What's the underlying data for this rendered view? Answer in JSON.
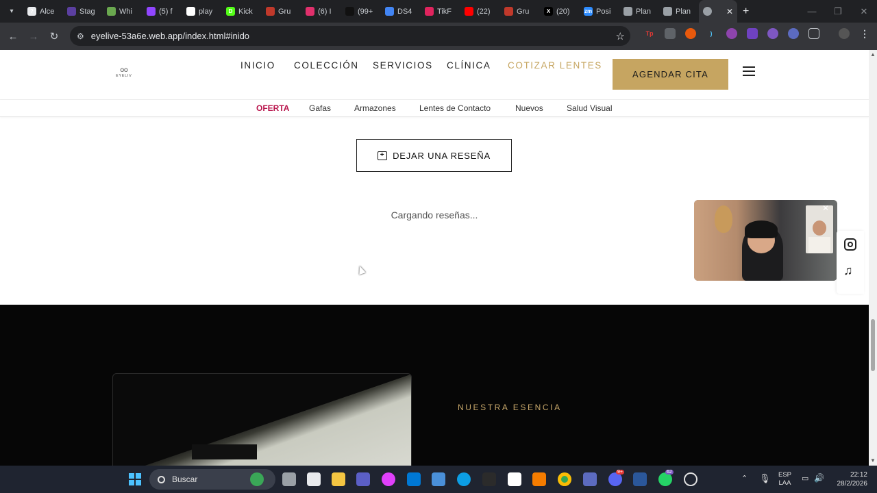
{
  "browser": {
    "tabs": [
      {
        "label": "Alce",
        "fav_color": "#e8eaed",
        "fav_glyph": "?"
      },
      {
        "label": "Stag",
        "fav_color": "#5b3fa0",
        "fav_glyph": ""
      },
      {
        "label": "Whi",
        "fav_color": "#6aa84f",
        "fav_glyph": ""
      },
      {
        "label": "(5) f",
        "fav_color": "#9146ff",
        "fav_glyph": ""
      },
      {
        "label": "play",
        "fav_color": "#ffffff",
        "fav_glyph": ""
      },
      {
        "label": "Kick",
        "fav_color": "#53fc18",
        "fav_glyph": "D"
      },
      {
        "label": "Gru",
        "fav_color": "#c0392b",
        "fav_glyph": ""
      },
      {
        "label": "(6) I",
        "fav_color": "#e1306c",
        "fav_glyph": ""
      },
      {
        "label": "(99+",
        "fav_color": "#111111",
        "fav_glyph": ""
      },
      {
        "label": "DS4",
        "fav_color": "#4285f4",
        "fav_glyph": ""
      },
      {
        "label": "TikF",
        "fav_color": "#e0245e",
        "fav_glyph": ""
      },
      {
        "label": "(22)",
        "fav_color": "#ff0000",
        "fav_glyph": ""
      },
      {
        "label": "Gru",
        "fav_color": "#c0392b",
        "fav_glyph": ""
      },
      {
        "label": "(20)",
        "fav_color": "#000000",
        "fav_glyph": "X"
      },
      {
        "label": "Posi",
        "fav_color": "#2d8cff",
        "fav_glyph": "zm"
      },
      {
        "label": "Plan",
        "fav_color": "#9aa0a6",
        "fav_glyph": ""
      },
      {
        "label": "Plan",
        "fav_color": "#9aa0a6",
        "fav_glyph": ""
      }
    ],
    "new_tab": "+",
    "url": "eyelive-53a6e.web.app/index.html#inido"
  },
  "site": {
    "logo_text": "EYELIV",
    "nav": [
      "INICIO",
      "COLECCIÓN",
      "SERVICIOS",
      "CLÍNICA",
      "COTIZAR LENTES"
    ],
    "cta": "AGENDAR CITA",
    "subnav": [
      "OFERTA",
      "Gafas",
      "Armazones",
      "Lentes de Contacto",
      "Nuevos",
      "Salud Visual"
    ],
    "review_button": "DEJAR UNA RESEÑA",
    "loading": "Cargando reseñas...",
    "essence_label": "NUESTRA ESENCIA",
    "accent": "#c6a561",
    "offer_color": "#b8124a"
  },
  "taskbar": {
    "search_label": "Buscar",
    "lang_line1": "ESP",
    "lang_line2": "LAA",
    "time": "22:12",
    "date": "28/2/2026",
    "badge_discord": "9+",
    "badge_whatsapp": "62"
  }
}
